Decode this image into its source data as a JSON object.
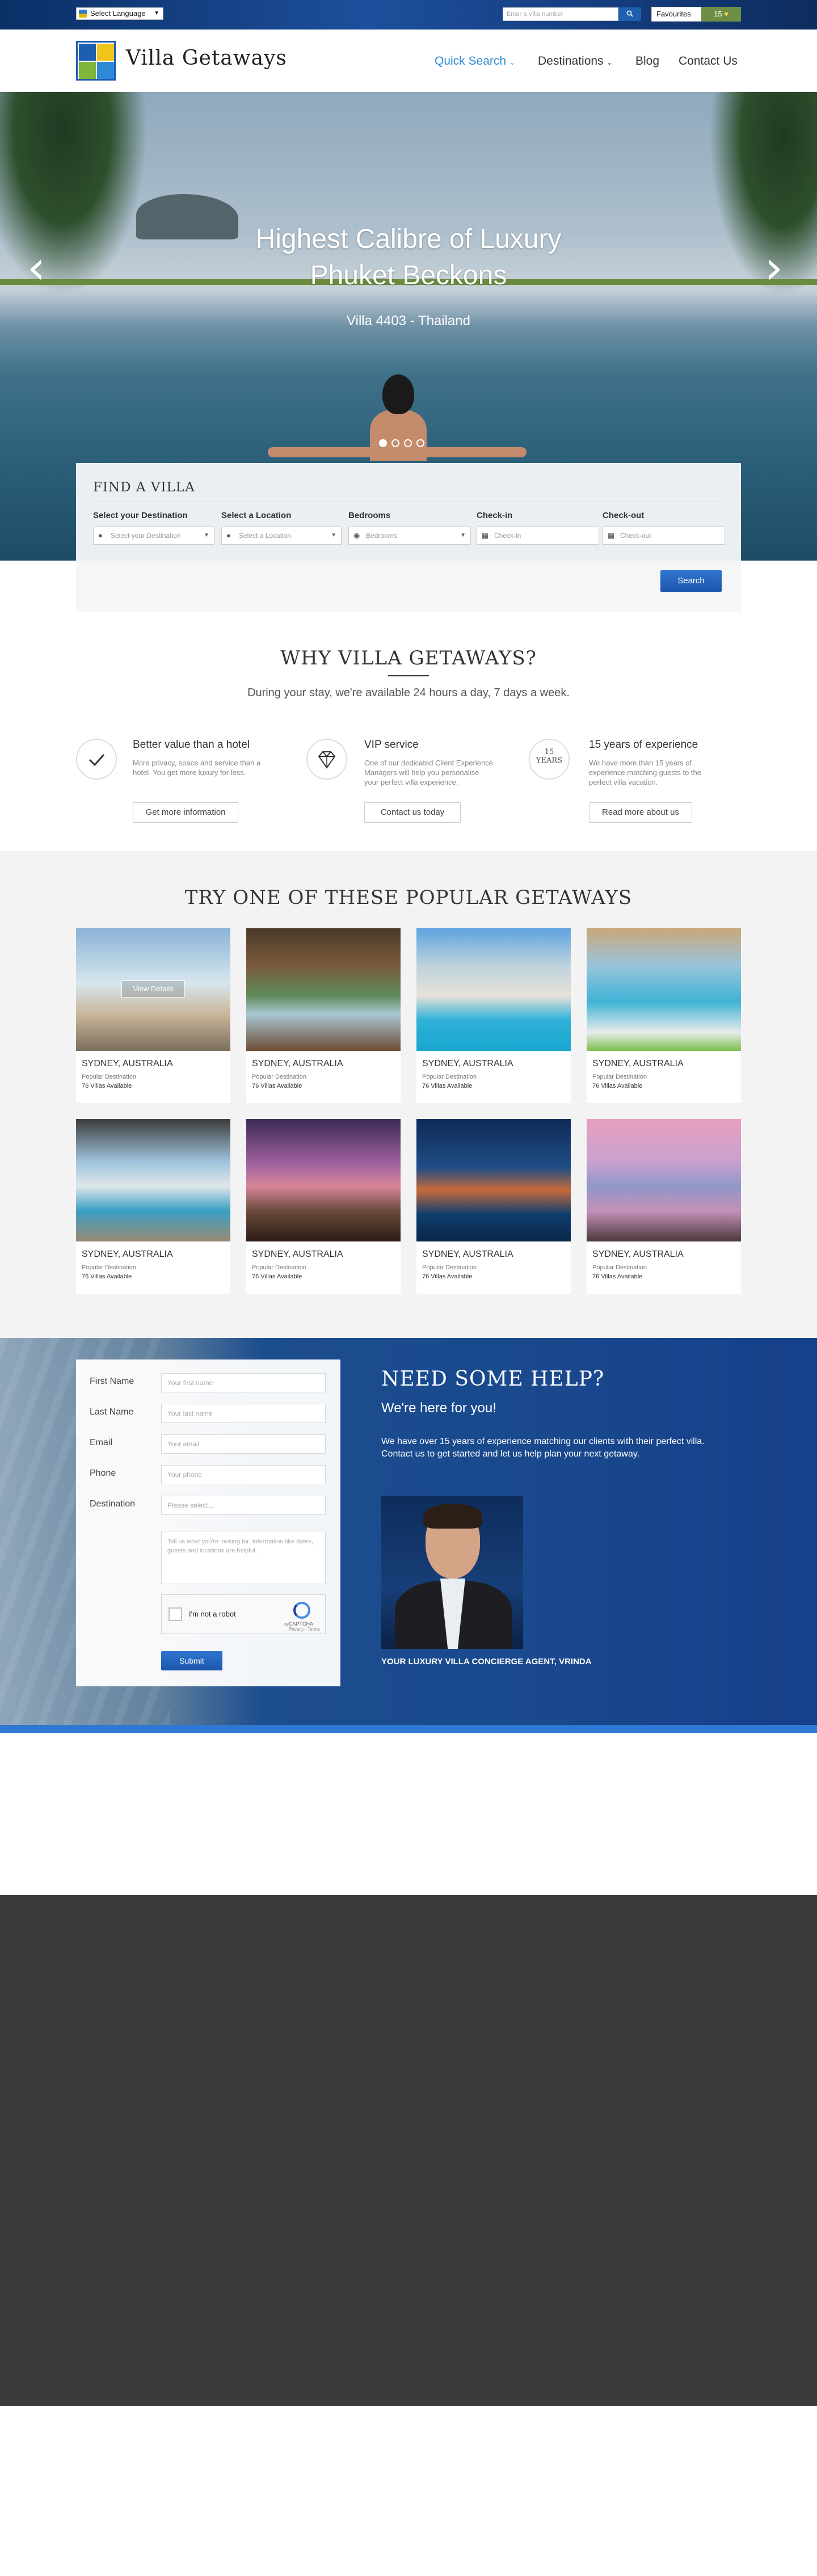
{
  "topbar": {
    "language_label": "Select Language",
    "villa_search_placeholder": "Enter a Villa number",
    "search_icon": "search-icon",
    "favourites_label": "Favourites",
    "favourites_count": "15"
  },
  "header": {
    "brand": "Villa Getaways",
    "nav": [
      {
        "label": "Quick Search",
        "active": true
      },
      {
        "label": "Destinations",
        "active": false
      },
      {
        "label": "Blog",
        "active": false
      },
      {
        "label": "Contact Us",
        "active": false
      }
    ]
  },
  "hero": {
    "title_line1": "Highest Calibre of Luxury",
    "title_line2": "Phuket Beckons",
    "subtitle": "Villa 4403 - Thailand",
    "slide_active": 1,
    "slide_count": 4
  },
  "find_villa": {
    "title": "FIND A VILLA",
    "fields": [
      {
        "label": "Select your Destination",
        "placeholder": "Select your Destination",
        "icon": "globe-icon"
      },
      {
        "label": "Select a Location",
        "placeholder": "Select a Location",
        "icon": "globe-icon"
      },
      {
        "label": "Bedrooms",
        "placeholder": "Bedrooms",
        "icon": "user-icon"
      },
      {
        "label": "Check-in",
        "placeholder": "Check-in",
        "icon": "calendar-icon"
      },
      {
        "label": "Check-out",
        "placeholder": "Check-out",
        "icon": "calendar-icon"
      }
    ],
    "search_label": "Search"
  },
  "why": {
    "title": "WHY VILLA GETAWAYS?",
    "subtitle": "During your stay, we're available 24 hours a day, 7 days a week.",
    "features": [
      {
        "icon": "checkmark-icon",
        "heading": "Better value than a hotel",
        "text": "More privacy, space and service than a hotel. You get more luxury for less.",
        "button": "Get more information"
      },
      {
        "icon": "diamond-icon",
        "heading": "VIP service",
        "text": "One of our dedicated Client Experience Managers will help you personalise your perfect villa experience.",
        "button": "Contact us today"
      },
      {
        "icon": "years-badge-icon",
        "badge_number": "15",
        "badge_word": "YEARS",
        "heading": "15 years of experience",
        "text": "We have more than 15 years of experience matching guests to the perfect villa vacation.",
        "button": "Read more about us"
      }
    ]
  },
  "getaways": {
    "title": "TRY ONE OF THESE POPULAR GETAWAYS",
    "view_details": "View Details",
    "cards": [
      {
        "location": "SYDNEY, AUSTRALIA",
        "tag": "Popular Destination",
        "count": "76 Villas Available"
      },
      {
        "location": "SYDNEY, AUSTRALIA",
        "tag": "Popular Destination",
        "count": "76 Villas Available"
      },
      {
        "location": "SYDNEY, AUSTRALIA",
        "tag": "Popular Destination",
        "count": "76 Villas Available"
      },
      {
        "location": "SYDNEY, AUSTRALIA",
        "tag": "Popular Destination",
        "count": "76 Villas Available"
      },
      {
        "location": "SYDNEY, AUSTRALIA",
        "tag": "Popular Destination",
        "count": "76 Villas Available"
      },
      {
        "location": "SYDNEY, AUSTRALIA",
        "tag": "Popular Destination",
        "count": "76 Villas Available"
      },
      {
        "location": "SYDNEY, AUSTRALIA",
        "tag": "Popular Destination",
        "count": "76 Villas Available"
      },
      {
        "location": "SYDNEY, AUSTRALIA",
        "tag": "Popular Destination",
        "count": "76 Villas Available"
      }
    ]
  },
  "help": {
    "form": {
      "first_name_label": "First Name",
      "first_name_placeholder": "Your first name",
      "last_name_label": "Last Name",
      "last_name_placeholder": "Your last name",
      "email_label": "Email",
      "email_placeholder": "Your email",
      "phone_label": "Phone",
      "phone_placeholder": "Your phone",
      "destination_label": "Destination",
      "destination_placeholder": "Please select...",
      "message_placeholder": "Tell us what you're looking for. Information like dates, guests and locations are helpful.",
      "captcha_label": "I'm not a robot",
      "captcha_brand": "reCAPTCHA",
      "captcha_terms": "Privacy - Terms",
      "submit_label": "Submit"
    },
    "heading": "NEED SOME HELP?",
    "subheading": "We're here for you!",
    "text": "We have over 15 years of experience matching our clients with their perfect villa. Contact us to get started and let us help plan your next getaway.",
    "agent_caption": "YOUR LUXURY VILLA CONCIERGE AGENT, VRINDA"
  },
  "colors": {
    "accent": "#2e8bd6",
    "button_blue": "#1d56ac",
    "topbar": "#163f83",
    "footer_dark": "#3a3a3a"
  }
}
